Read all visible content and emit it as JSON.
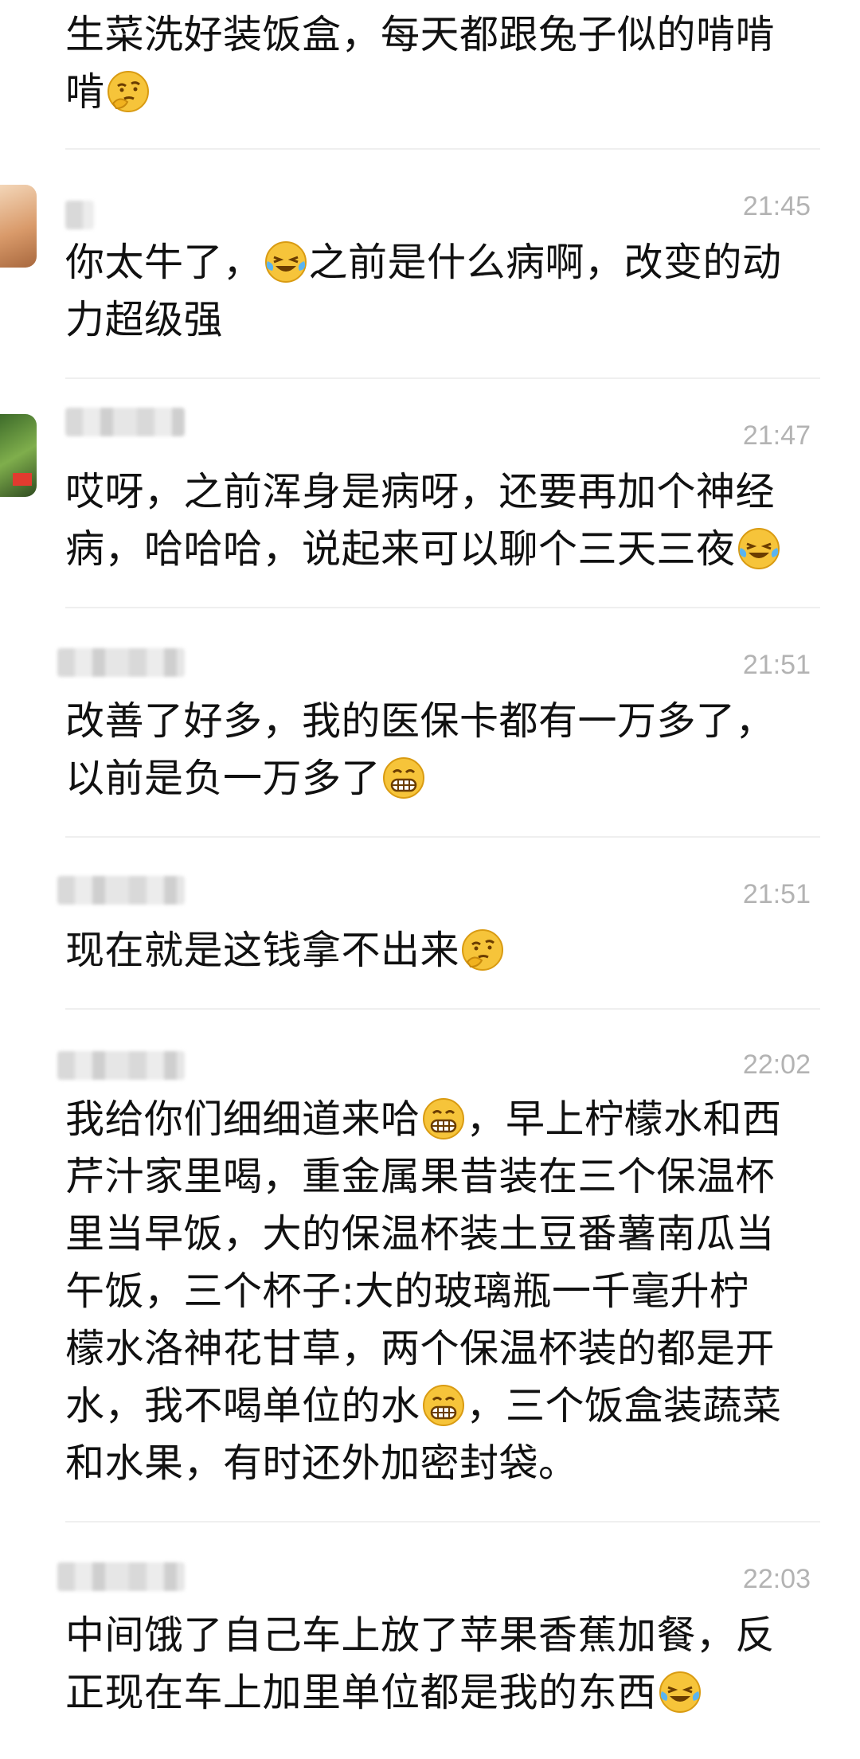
{
  "comments": [
    {
      "id": "c0",
      "time": "",
      "text_parts": [
        "生菜洗好装饭盒，每天都跟兔子似的啃啃",
        "啃"
      ],
      "emojis": [
        "thinking-emoji"
      ]
    },
    {
      "id": "c1",
      "time": "21:45",
      "text_parts": [
        "你太牛了，",
        "之前是什么病啊，改变的动",
        "力超级强"
      ],
      "emojis": [
        "laugh-cry-emoji"
      ]
    },
    {
      "id": "c2",
      "time": "21:47",
      "text_parts": [
        "哎呀，之前浑身是病呀，还要再加个神经",
        "病，哈哈哈，说起来可以聊个三天三夜"
      ],
      "emojis": [
        "laugh-cry-emoji"
      ]
    },
    {
      "id": "c3",
      "time": "21:51",
      "text_parts": [
        "改善了好多，我的医保卡都有一万多了，",
        "以前是负一万多了"
      ],
      "emojis": [
        "grin-emoji"
      ]
    },
    {
      "id": "c4",
      "time": "21:51",
      "text_parts": [
        "现在就是这钱拿不出来"
      ],
      "emojis": [
        "thinking-emoji"
      ]
    },
    {
      "id": "c5",
      "time": "22:02",
      "text_parts": [
        "我给你们细细道来哈",
        "，早上柠檬水和西",
        "芹汁家里喝，重金属果昔装在三个保温杯",
        "里当早饭，大的保温杯装土豆番薯南瓜当",
        "午饭，三个杯子:大的玻璃瓶一千毫升柠",
        "檬水洛神花甘草，两个保温杯装的都是开",
        "水，我不喝单位的水",
        "，三个饭盒装蔬菜",
        "和水果，有时还外加密封袋。"
      ],
      "emojis": [
        "grin-emoji",
        "grin-emoji"
      ]
    },
    {
      "id": "c6",
      "time": "22:03",
      "text_parts": [
        "中间饿了自己车上放了苹果香蕉加餐，反",
        "正现在车上加里单位都是我的东西"
      ],
      "emojis": [
        "laugh-cry-emoji"
      ]
    }
  ],
  "colors": {
    "background": "#ffffff",
    "text": "#111111",
    "time": "#b3b3b3",
    "divider": "#efefef",
    "emoji_face": "#f6c43a"
  }
}
